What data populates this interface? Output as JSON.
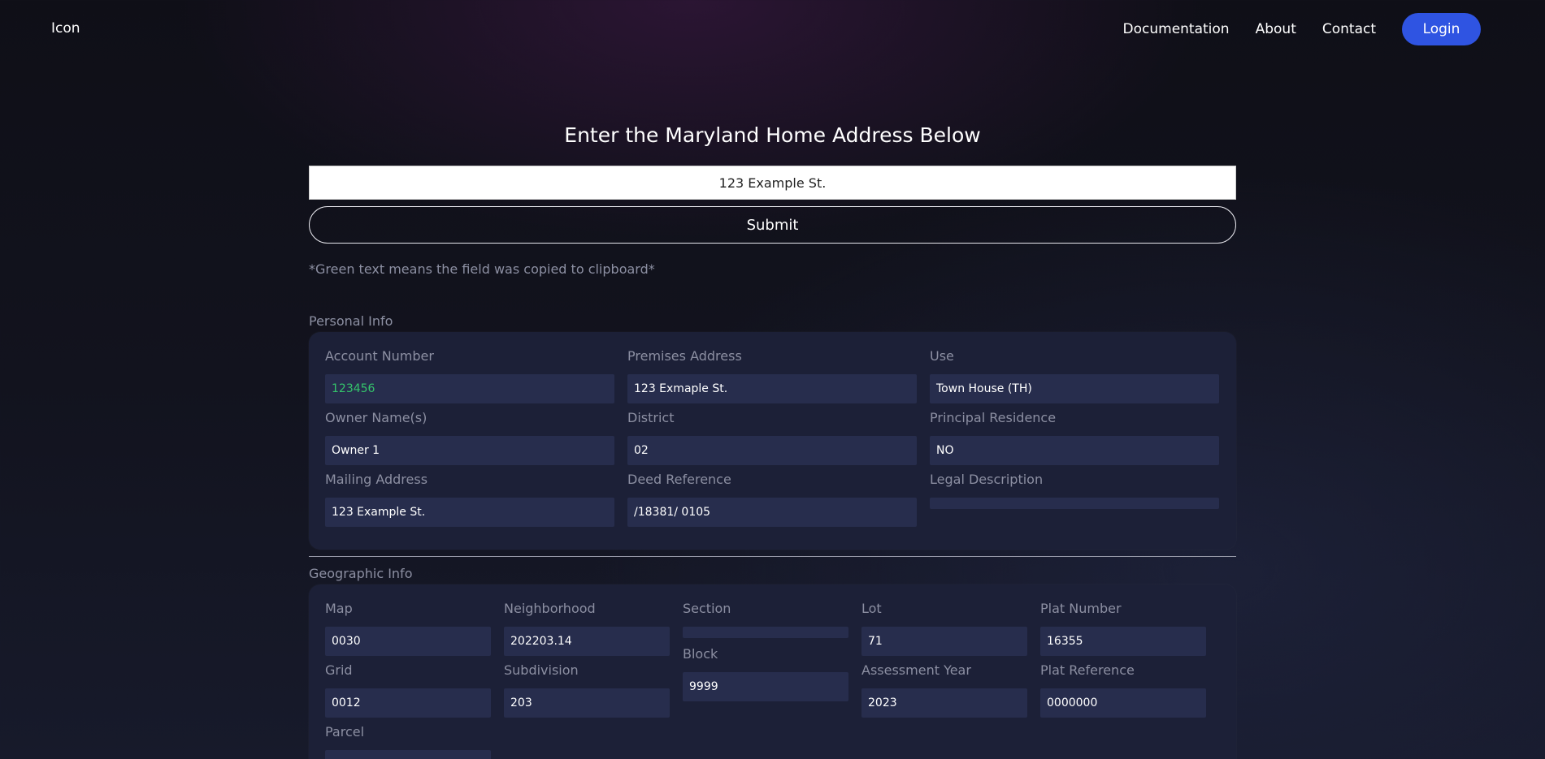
{
  "nav": {
    "brand": "Icon",
    "links": [
      "Documentation",
      "About",
      "Contact"
    ],
    "login_label": "Login"
  },
  "main": {
    "heading": "Enter the Maryland Home Address Below",
    "address_value": "123 Example St.",
    "submit_label": "Submit",
    "note": "*Green text means the field was copied to clipboard*"
  },
  "personal": {
    "section_title": "Personal Info",
    "fields": {
      "account_number": {
        "label": "Account Number",
        "value": "123456"
      },
      "premises_address": {
        "label": "Premises Address",
        "value": "123 Exmaple St."
      },
      "use": {
        "label": "Use",
        "value": "Town House (TH)"
      },
      "owner_names": {
        "label": "Owner Name(s)",
        "value": "Owner 1"
      },
      "district": {
        "label": "District",
        "value": "02"
      },
      "principal_residence": {
        "label": "Principal Residence",
        "value": "NO"
      },
      "mailing_address": {
        "label": "Mailing Address",
        "value": "123 Example St."
      },
      "deed_reference": {
        "label": "Deed Reference",
        "value": "/18381/ 0105"
      },
      "legal_description": {
        "label": "Legal Description",
        "value": ""
      }
    }
  },
  "geographic": {
    "section_title": "Geographic Info",
    "fields": {
      "map": {
        "label": "Map",
        "value": "0030"
      },
      "neighborhood": {
        "label": "Neighborhood",
        "value": "202203.14"
      },
      "section": {
        "label": "Section",
        "value": ""
      },
      "lot": {
        "label": "Lot",
        "value": "71"
      },
      "plat_number": {
        "label": "Plat Number",
        "value": "16355"
      },
      "grid": {
        "label": "Grid",
        "value": "0012"
      },
      "subdivision": {
        "label": "Subdivision",
        "value": "203"
      },
      "block": {
        "label": "Block",
        "value": "9999"
      },
      "assessment_year": {
        "label": "Assessment Year",
        "value": "2023"
      },
      "plat_reference": {
        "label": "Plat Reference",
        "value": "0000000"
      },
      "parcel": {
        "label": "Parcel",
        "value": ""
      }
    }
  },
  "colors": {
    "accent": "#2f54e2",
    "copied_text": "#34c46b",
    "card_bg": "#1c2037",
    "field_bg": "#272d4d"
  }
}
